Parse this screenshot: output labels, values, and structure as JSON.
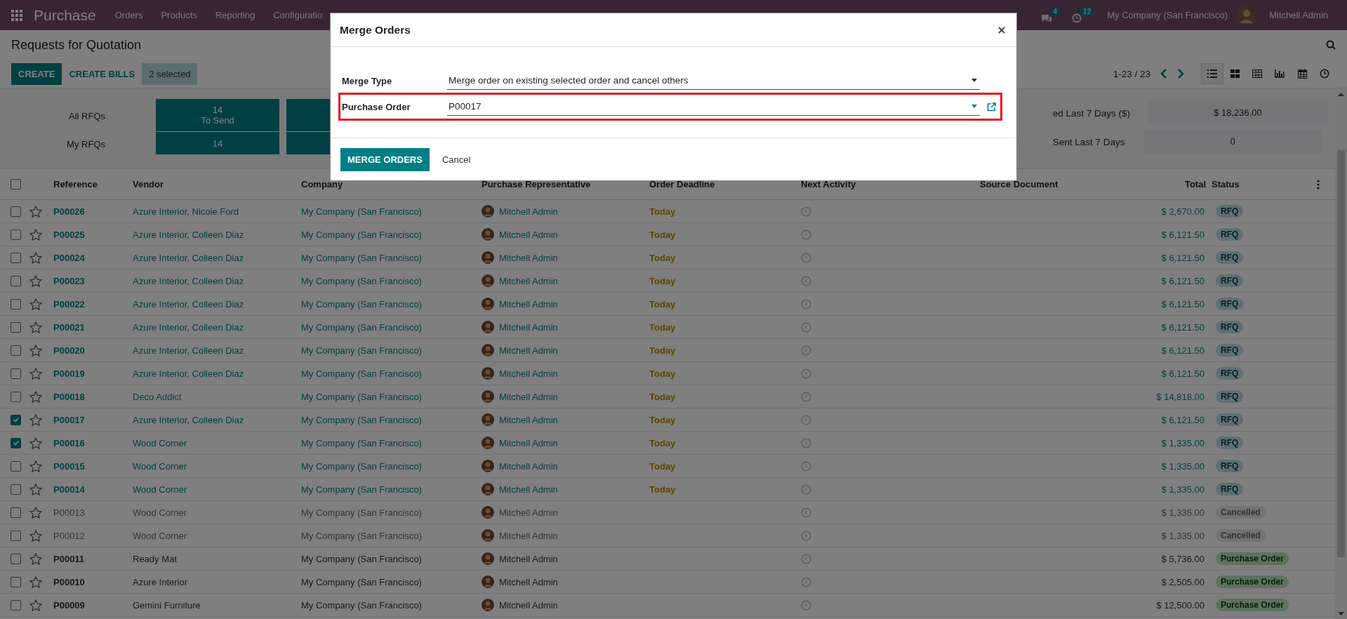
{
  "navbar": {
    "app": "Purchase",
    "menus": [
      "Orders",
      "Products",
      "Reporting",
      "Configuratio"
    ],
    "messages_badge": "4",
    "activities_badge": "12",
    "company": "My Company (San Francisco)",
    "user": "Mitchell Admin"
  },
  "control_panel": {
    "title": "Requests for Quotation",
    "buttons": [
      "CREATE",
      "CREATE BILLS"
    ],
    "selection": "2 selected",
    "pager": "1-23 / 23",
    "views": [
      {
        "kind": "list",
        "selected": true
      },
      {
        "kind": "kanban",
        "selected": false
      },
      {
        "kind": "pivot",
        "selected": false
      },
      {
        "kind": "graph",
        "selected": false
      },
      {
        "kind": "calendar",
        "selected": false
      },
      {
        "kind": "activity",
        "selected": false
      }
    ]
  },
  "dashboard": {
    "row_labels": [
      "All RFQs",
      "My RFQs"
    ],
    "to_send_count": "14",
    "to_send_label": "To Send",
    "my_to_send_count": "14",
    "stats": [
      {
        "label": "ed Last 7 Days ($)",
        "value": "$ 18,236.00"
      },
      {
        "label": "Sent Last 7 Days",
        "value": "0"
      }
    ]
  },
  "table": {
    "select_all_checked": false,
    "columns": [
      "Reference",
      "Vendor",
      "Company",
      "Purchase Representative",
      "Order Deadline",
      "Next Activity",
      "Source Document",
      "Total",
      "Status"
    ],
    "rows": [
      {
        "checked": false,
        "starred": false,
        "reference": "P00026",
        "vendor": "Azure Interior, Nicole Ford",
        "company": "My Company (San Francisco)",
        "representative": "Mitchell Admin",
        "deadline": "Today",
        "total": "$ 2,670.00",
        "status": {
          "label": "RFQ",
          "kind": "rfq"
        }
      },
      {
        "checked": false,
        "starred": false,
        "reference": "P00025",
        "vendor": "Azure Interior, Colleen Diaz",
        "company": "My Company (San Francisco)",
        "representative": "Mitchell Admin",
        "deadline": "Today",
        "total": "$ 6,121.50",
        "status": {
          "label": "RFQ",
          "kind": "rfq"
        }
      },
      {
        "checked": false,
        "starred": false,
        "reference": "P00024",
        "vendor": "Azure Interior, Colleen Diaz",
        "company": "My Company (San Francisco)",
        "representative": "Mitchell Admin",
        "deadline": "Today",
        "total": "$ 6,121.50",
        "status": {
          "label": "RFQ",
          "kind": "rfq"
        }
      },
      {
        "checked": false,
        "starred": false,
        "reference": "P00023",
        "vendor": "Azure Interior, Colleen Diaz",
        "company": "My Company (San Francisco)",
        "representative": "Mitchell Admin",
        "deadline": "Today",
        "total": "$ 6,121.50",
        "status": {
          "label": "RFQ",
          "kind": "rfq"
        }
      },
      {
        "checked": false,
        "starred": false,
        "reference": "P00022",
        "vendor": "Azure Interior, Colleen Diaz",
        "company": "My Company (San Francisco)",
        "representative": "Mitchell Admin",
        "deadline": "Today",
        "total": "$ 6,121.50",
        "status": {
          "label": "RFQ",
          "kind": "rfq"
        }
      },
      {
        "checked": false,
        "starred": false,
        "reference": "P00021",
        "vendor": "Azure Interior, Colleen Diaz",
        "company": "My Company (San Francisco)",
        "representative": "Mitchell Admin",
        "deadline": "Today",
        "total": "$ 6,121.50",
        "status": {
          "label": "RFQ",
          "kind": "rfq"
        }
      },
      {
        "checked": false,
        "starred": false,
        "reference": "P00020",
        "vendor": "Azure Interior, Colleen Diaz",
        "company": "My Company (San Francisco)",
        "representative": "Mitchell Admin",
        "deadline": "Today",
        "total": "$ 6,121.50",
        "status": {
          "label": "RFQ",
          "kind": "rfq"
        }
      },
      {
        "checked": false,
        "starred": false,
        "reference": "P00019",
        "vendor": "Azure Interior, Colleen Diaz",
        "company": "My Company (San Francisco)",
        "representative": "Mitchell Admin",
        "deadline": "Today",
        "total": "$ 6,121.50",
        "status": {
          "label": "RFQ",
          "kind": "rfq"
        }
      },
      {
        "checked": false,
        "starred": false,
        "reference": "P00018",
        "vendor": "Deco Addict",
        "company": "My Company (San Francisco)",
        "representative": "Mitchell Admin",
        "deadline": "Today",
        "total": "$ 14,818.00",
        "status": {
          "label": "RFQ",
          "kind": "rfq"
        }
      },
      {
        "checked": true,
        "starred": false,
        "reference": "P00017",
        "vendor": "Azure Interior, Colleen Diaz",
        "company": "My Company (San Francisco)",
        "representative": "Mitchell Admin",
        "deadline": "Today",
        "total": "$ 6,121.50",
        "status": {
          "label": "RFQ",
          "kind": "rfq"
        }
      },
      {
        "checked": true,
        "starred": false,
        "reference": "P00016",
        "vendor": "Wood Corner",
        "company": "My Company (San Francisco)",
        "representative": "Mitchell Admin",
        "deadline": "Today",
        "total": "$ 1,335.00",
        "status": {
          "label": "RFQ",
          "kind": "rfq"
        }
      },
      {
        "checked": false,
        "starred": false,
        "reference": "P00015",
        "vendor": "Wood Corner",
        "company": "My Company (San Francisco)",
        "representative": "Mitchell Admin",
        "deadline": "Today",
        "total": "$ 1,335.00",
        "status": {
          "label": "RFQ",
          "kind": "rfq"
        }
      },
      {
        "checked": false,
        "starred": false,
        "reference": "P00014",
        "vendor": "Wood Corner",
        "company": "My Company (San Francisco)",
        "representative": "Mitchell Admin",
        "deadline": "Today",
        "total": "$ 1,335.00",
        "status": {
          "label": "RFQ",
          "kind": "rfq"
        }
      },
      {
        "checked": false,
        "starred": false,
        "reference": "P00013",
        "vendor": "Wood Corner",
        "company": "My Company (San Francisco)",
        "representative": "Mitchell Admin",
        "total": "$ 1,335.00",
        "status": {
          "label": "Cancelled",
          "kind": "cancelled"
        }
      },
      {
        "checked": false,
        "starred": false,
        "reference": "P00012",
        "vendor": "Wood Corner",
        "company": "My Company (San Francisco)",
        "representative": "Mitchell Admin",
        "total": "$ 1,335.00",
        "status": {
          "label": "Cancelled",
          "kind": "cancelled"
        }
      },
      {
        "checked": false,
        "starred": false,
        "reference": "P00011",
        "vendor": "Ready Mat",
        "company": "My Company (San Francisco)",
        "representative": "Mitchell Admin",
        "total": "$ 5,736.00",
        "status": {
          "label": "Purchase Order",
          "kind": "purchase"
        }
      },
      {
        "checked": false,
        "starred": false,
        "reference": "P00010",
        "vendor": "Azure Interior",
        "company": "My Company (San Francisco)",
        "representative": "Mitchell Admin",
        "total": "$ 2,505.00",
        "status": {
          "label": "Purchase Order",
          "kind": "purchase"
        }
      },
      {
        "checked": false,
        "starred": false,
        "reference": "P00009",
        "vendor": "Gemini Furniture",
        "company": "My Company (San Francisco)",
        "representative": "Mitchell Admin",
        "total": "$ 12,500.00",
        "status": {
          "label": "Purchase Order",
          "kind": "purchase"
        }
      }
    ]
  },
  "dialog": {
    "title": "Merge Orders",
    "fields": [
      {
        "label": "Merge Type",
        "value": "Merge order on existing selected order and cancel others",
        "kind": "select",
        "highlighted": false
      },
      {
        "label": "Purchase Order",
        "value": "P00017",
        "kind": "many2one",
        "highlighted": true
      }
    ],
    "buttons": [
      "MERGE ORDERS",
      "Cancel"
    ]
  }
}
